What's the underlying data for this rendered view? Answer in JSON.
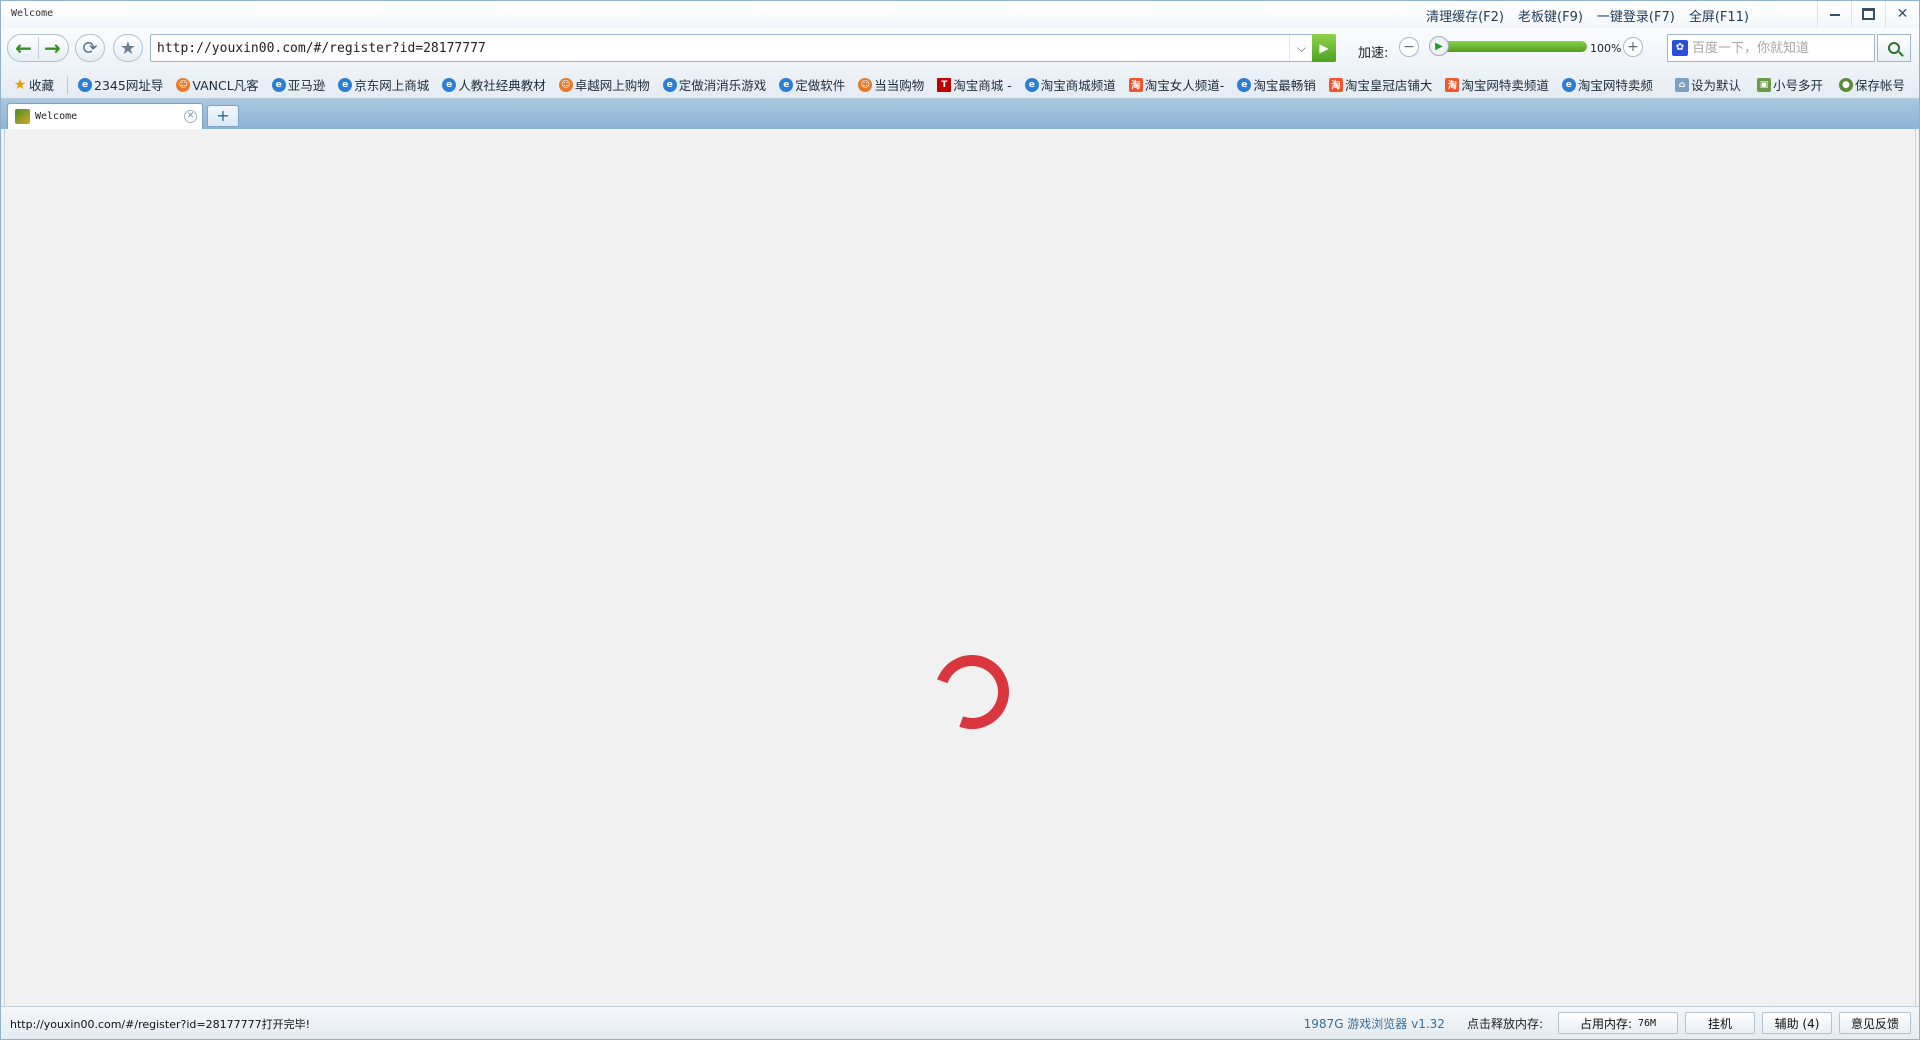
{
  "window": {
    "title": "Welcome"
  },
  "title_actions": [
    "清理缓存(F2)",
    "老板键(F9)",
    "一键登录(F7)",
    "全屏(F11)"
  ],
  "nav": {
    "url": "http://youxin00.com/#/register?id=28177777",
    "speed_label": "加速:",
    "speed_value": "100%",
    "speed_fraction": 1.0,
    "search_placeholder": "百度一下，你就知道"
  },
  "bookmarks": {
    "left": [
      {
        "label": "收藏",
        "icon": "star-icon"
      },
      {
        "label": "2345网址导",
        "icon": "ie-icon"
      },
      {
        "label": "VANCL凡客",
        "icon": "face-icon"
      },
      {
        "label": "亚马逊",
        "icon": "ie-icon"
      },
      {
        "label": "京东网上商城",
        "icon": "ie-icon"
      },
      {
        "label": "人教社经典教材",
        "icon": "ie-icon"
      },
      {
        "label": "卓越网上购物",
        "icon": "face-icon"
      },
      {
        "label": "定做消消乐游戏",
        "icon": "ie-icon"
      },
      {
        "label": "定做软件",
        "icon": "ie-icon"
      },
      {
        "label": "当当购物",
        "icon": "face-icon"
      },
      {
        "label": "淘宝商城 -",
        "icon": "tmall-icon"
      },
      {
        "label": "淘宝商城频道",
        "icon": "ie-icon"
      },
      {
        "label": "淘宝女人频道-",
        "icon": "taobao-icon"
      },
      {
        "label": "淘宝最畅销",
        "icon": "ie-icon"
      },
      {
        "label": "淘宝皇冠店铺大",
        "icon": "taobao-icon"
      },
      {
        "label": "淘宝网特卖频道",
        "icon": "taobao-icon"
      },
      {
        "label": "淘宝网特卖频",
        "icon": "ie-icon"
      }
    ],
    "right": [
      {
        "label": "设为默认",
        "icon": "home-icon"
      },
      {
        "label": "小号多开",
        "icon": "windows-icon"
      },
      {
        "label": "保存帐号",
        "icon": "user-icon"
      }
    ]
  },
  "tabs": [
    {
      "title": "Welcome"
    }
  ],
  "status": {
    "text": "http://youxin00.com/#/register?id=28177777打开完毕!",
    "version": "1987G 游戏浏览器 v1.32",
    "release_label": "点击释放内存:",
    "memory_label": "占用内存:",
    "memory_value": "76M",
    "hang_label": "挂机",
    "assist_label": "辅助 (4)",
    "feedback_label": "意见反馈"
  },
  "colors": {
    "spinner": "#d9363e",
    "accent_green": "#4aa521",
    "tab_bar": "#8eb4d3"
  }
}
